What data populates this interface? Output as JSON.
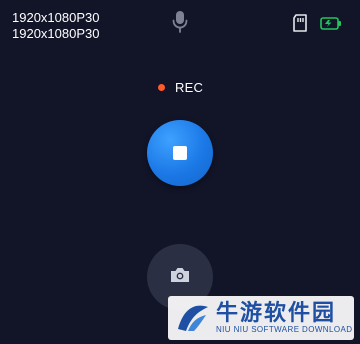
{
  "resolution": {
    "line1": "1920x1080P30",
    "line2": "1920x1080P30"
  },
  "icons": {
    "mic": "microphone-icon",
    "sd": "sd-card-icon",
    "battery": "battery-charging-icon",
    "stop": "stop-icon",
    "camera": "camera-icon"
  },
  "recording": {
    "label": "REC",
    "dot_color": "#ff5a2c"
  },
  "colors": {
    "background": "#121428",
    "accent": "#1b78e6",
    "battery": "#22c55e"
  },
  "watermark": {
    "cn": "牛游软件园",
    "en": "NIU NIU SOFTWARE DOWNLOAD"
  }
}
